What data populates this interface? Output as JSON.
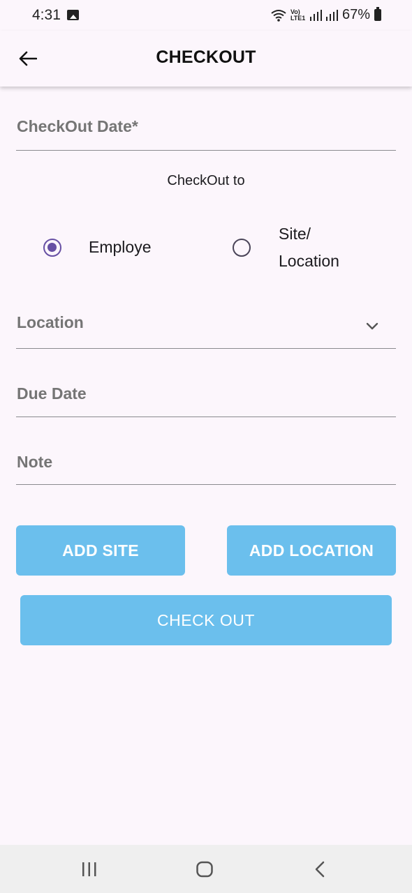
{
  "status_bar": {
    "time": "4:31",
    "network": "Vo) LTE1",
    "battery": "67%"
  },
  "app_bar": {
    "title": "CHECKOUT"
  },
  "form": {
    "checkout_date_label": "CheckOut Date*",
    "checkout_to_label": "CheckOut to",
    "radio_options": [
      {
        "label": "Employe",
        "selected": true
      },
      {
        "label": "Site/\nLocation",
        "selected": false
      }
    ],
    "location_label": "Location",
    "due_date_label": "Due Date",
    "note_label": "Note"
  },
  "buttons": {
    "add_site": "ADD SITE",
    "add_location": "ADD LOCATION",
    "check_out": "CHECK OUT"
  },
  "colors": {
    "background": "#fcf6fc",
    "accent": "#6750a4",
    "button": "#6bbfed"
  }
}
